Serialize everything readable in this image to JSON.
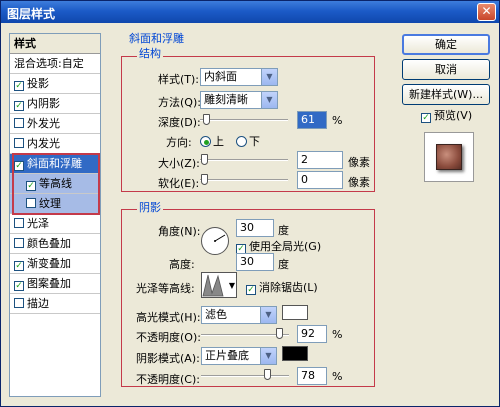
{
  "window": {
    "title": "图层样式",
    "close_glyph": "✕"
  },
  "styles": {
    "header": "样式",
    "blend_options": "混合选项:自定",
    "items": [
      {
        "label": "投影",
        "checked": true
      },
      {
        "label": "内阴影",
        "checked": true
      },
      {
        "label": "外发光",
        "checked": false
      },
      {
        "label": "内发光",
        "checked": false
      },
      {
        "label": "斜面和浮雕",
        "checked": true
      },
      {
        "label": "等高线",
        "checked": true
      },
      {
        "label": "纹理",
        "checked": false
      },
      {
        "label": "光泽",
        "checked": false
      },
      {
        "label": "颜色叠加",
        "checked": false
      },
      {
        "label": "渐变叠加",
        "checked": true
      },
      {
        "label": "图案叠加",
        "checked": true
      },
      {
        "label": "描边",
        "checked": false
      }
    ]
  },
  "bevel": {
    "section_title": "斜面和浮雕",
    "structure": {
      "title": "结构",
      "style_label": "样式(T):",
      "style_value": "内斜面",
      "technique_label": "方法(Q):",
      "technique_value": "雕刻清晰",
      "depth_label": "深度(D):",
      "depth_value": "61",
      "depth_unit": "%",
      "depth_fraction": 0.61,
      "direction_label": "方向:",
      "direction_up": "上",
      "direction_down": "下",
      "size_label": "大小(Z):",
      "size_value": "2",
      "size_unit": "像素",
      "soften_label": "软化(E):",
      "soften_value": "0",
      "soften_unit": "像素"
    },
    "shading": {
      "title": "阴影",
      "angle_label": "角度(N):",
      "angle_value": "30",
      "angle_unit": "度",
      "global_light_label": "使用全局光(G)",
      "altitude_label": "高度:",
      "altitude_value": "30",
      "altitude_unit": "度",
      "gloss_contour_label": "光泽等高线:",
      "anti_alias_label": "消除锯齿(L)",
      "highlight_mode_label": "高光模式(H):",
      "highlight_mode_value": "滤色",
      "highlight_color": "#ffffff",
      "highlight_opacity_label": "不透明度(O):",
      "highlight_opacity_value": "92",
      "highlight_opacity_unit": "%",
      "highlight_opacity_fraction": 0.92,
      "shadow_mode_label": "阴影模式(A):",
      "shadow_mode_value": "正片叠底",
      "shadow_color": "#000000",
      "shadow_opacity_label": "不透明度(C):",
      "shadow_opacity_value": "78",
      "shadow_opacity_unit": "%",
      "shadow_opacity_fraction": 0.78
    }
  },
  "buttons": {
    "ok": "确定",
    "cancel": "取消",
    "new_style": "新建样式(W)...",
    "preview_label": "预览(V)"
  },
  "colors": {
    "titlebar": "#1c5bc7",
    "selected": "#316ac5",
    "group_title": "#0046d5",
    "highlight_border": "#c43a4a"
  }
}
